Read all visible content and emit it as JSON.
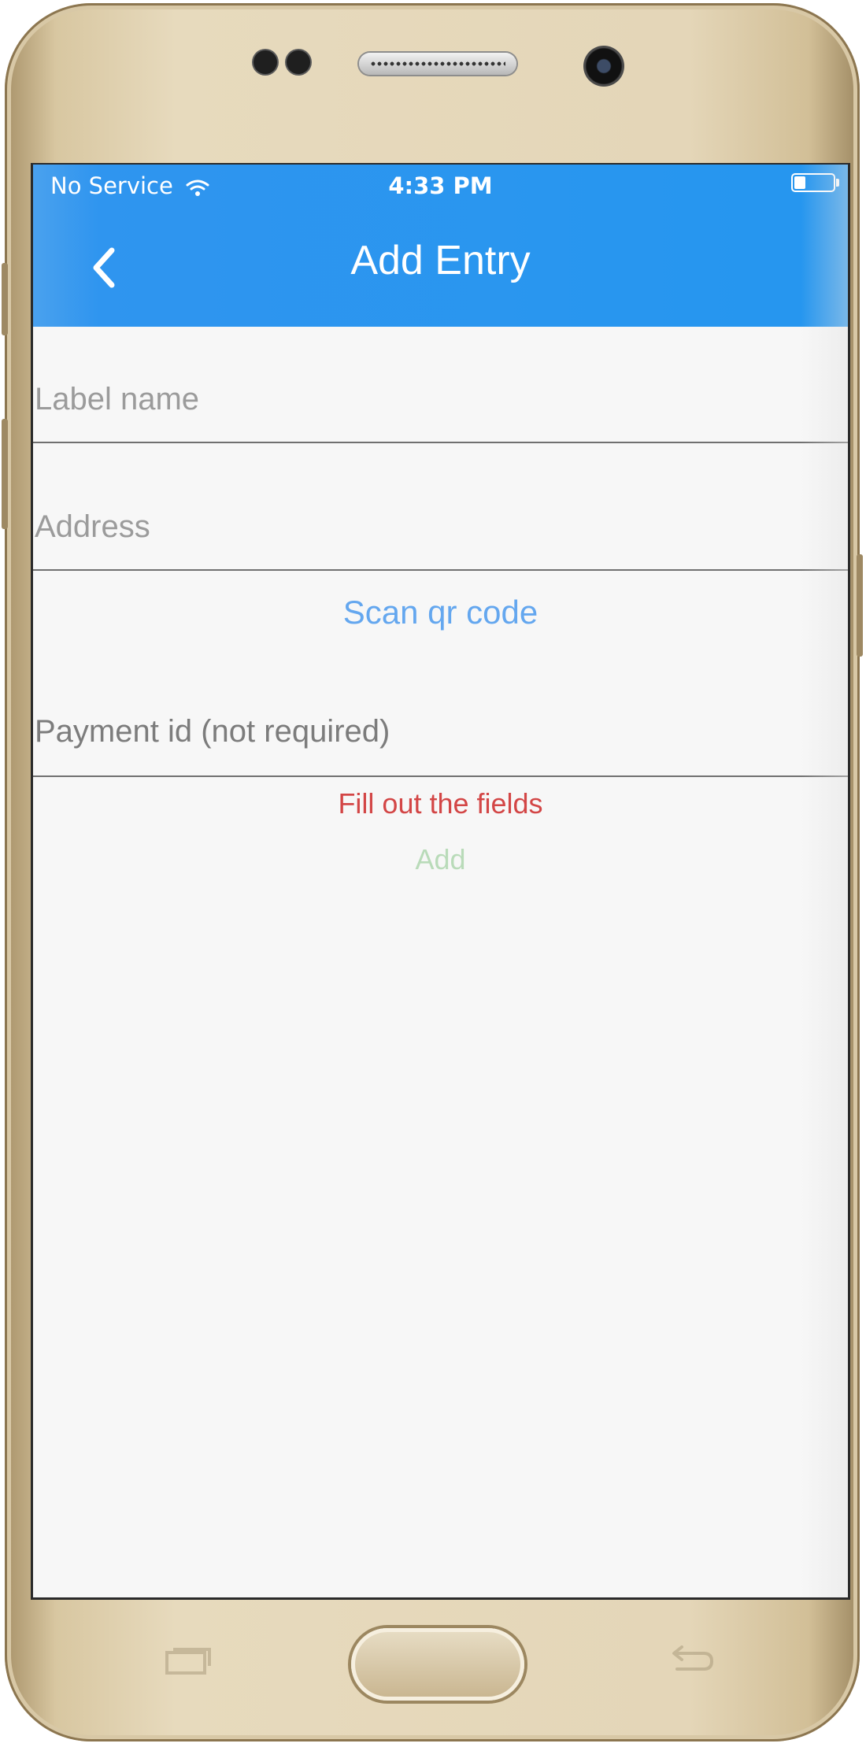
{
  "status_bar": {
    "carrier": "No Service",
    "time": "4:33 PM"
  },
  "header": {
    "title": "Add Entry"
  },
  "form": {
    "label_name_placeholder": "Label name",
    "address_placeholder": "Address",
    "payment_id_placeholder": "Payment id (not required)",
    "scan_qr_label": "Scan qr code",
    "validation_message": "Fill out the fields",
    "add_label": "Add"
  },
  "icons": {
    "back": "chevron-left-icon",
    "wifi": "wifi-icon",
    "battery": "battery-icon",
    "recent_apps": "recent-apps-icon",
    "back_key": "back-key-icon"
  },
  "colors": {
    "header": "#2596ef",
    "link": "#64a7ef",
    "error": "#d34646",
    "add_disabled": "#b9dbb9",
    "background": "#f7f7f7"
  }
}
